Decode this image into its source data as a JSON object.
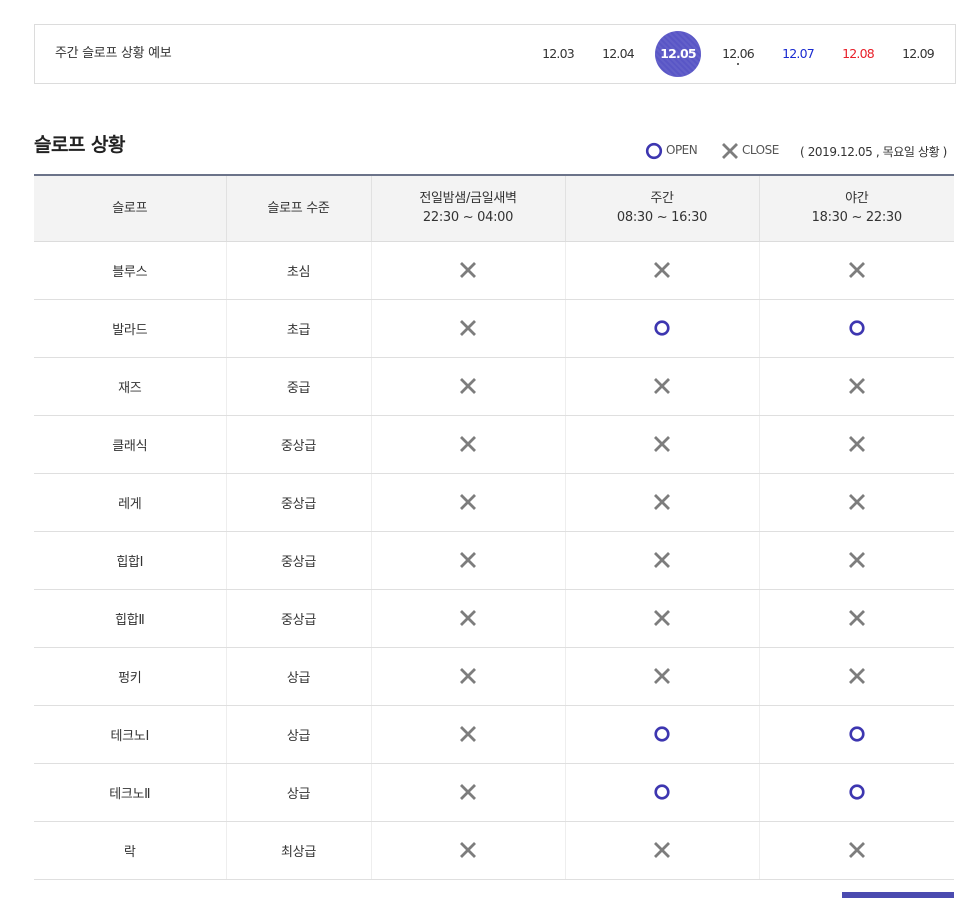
{
  "forecast": {
    "title": "주간 슬로프 상황 예보",
    "dates": [
      {
        "label": "12.03",
        "style": "normal"
      },
      {
        "label": "12.04",
        "style": "normal"
      },
      {
        "label": "12.05",
        "style": "active"
      },
      {
        "label": "12.06",
        "style": "normal"
      },
      {
        "label": "12.07",
        "style": "blue"
      },
      {
        "label": "12.08",
        "style": "red"
      },
      {
        "label": "12.09",
        "style": "normal"
      }
    ]
  },
  "section": {
    "title": "슬로프 상황",
    "legend_open": "OPEN",
    "legend_close": "CLOSE",
    "status_date": "( 2019.12.05 , 목요일 상황 )"
  },
  "colors": {
    "accent": "#5956c6",
    "open_mark": "#3d36b0",
    "close_mark": "#7d7d7d",
    "weekend_blue": "#1a2bd0",
    "holiday_red": "#e8202a"
  },
  "table": {
    "headers": [
      {
        "line1": "슬로프",
        "line2": ""
      },
      {
        "line1": "슬로프 수준",
        "line2": ""
      },
      {
        "line1": "전일밤샘/금일새벽",
        "line2": "22:30 ~ 04:00"
      },
      {
        "line1": "주간",
        "line2": "08:30 ~ 16:30"
      },
      {
        "line1": "야간",
        "line2": "18:30 ~ 22:30"
      }
    ],
    "rows": [
      {
        "slope": "블루스",
        "level": "초심",
        "overnight": "close",
        "day": "close",
        "night": "close"
      },
      {
        "slope": "발라드",
        "level": "초급",
        "overnight": "close",
        "day": "open",
        "night": "open"
      },
      {
        "slope": "재즈",
        "level": "중급",
        "overnight": "close",
        "day": "close",
        "night": "close"
      },
      {
        "slope": "클래식",
        "level": "중상급",
        "overnight": "close",
        "day": "close",
        "night": "close"
      },
      {
        "slope": "레게",
        "level": "중상급",
        "overnight": "close",
        "day": "close",
        "night": "close"
      },
      {
        "slope": "힙합Ⅰ",
        "level": "중상급",
        "overnight": "close",
        "day": "close",
        "night": "close"
      },
      {
        "slope": "힙합Ⅱ",
        "level": "중상급",
        "overnight": "close",
        "day": "close",
        "night": "close"
      },
      {
        "slope": "펑키",
        "level": "상급",
        "overnight": "close",
        "day": "close",
        "night": "close"
      },
      {
        "slope": "테크노Ⅰ",
        "level": "상급",
        "overnight": "close",
        "day": "open",
        "night": "open"
      },
      {
        "slope": "테크노Ⅱ",
        "level": "상급",
        "overnight": "close",
        "day": "open",
        "night": "open"
      },
      {
        "slope": "락",
        "level": "최상급",
        "overnight": "close",
        "day": "close",
        "night": "close"
      }
    ]
  }
}
